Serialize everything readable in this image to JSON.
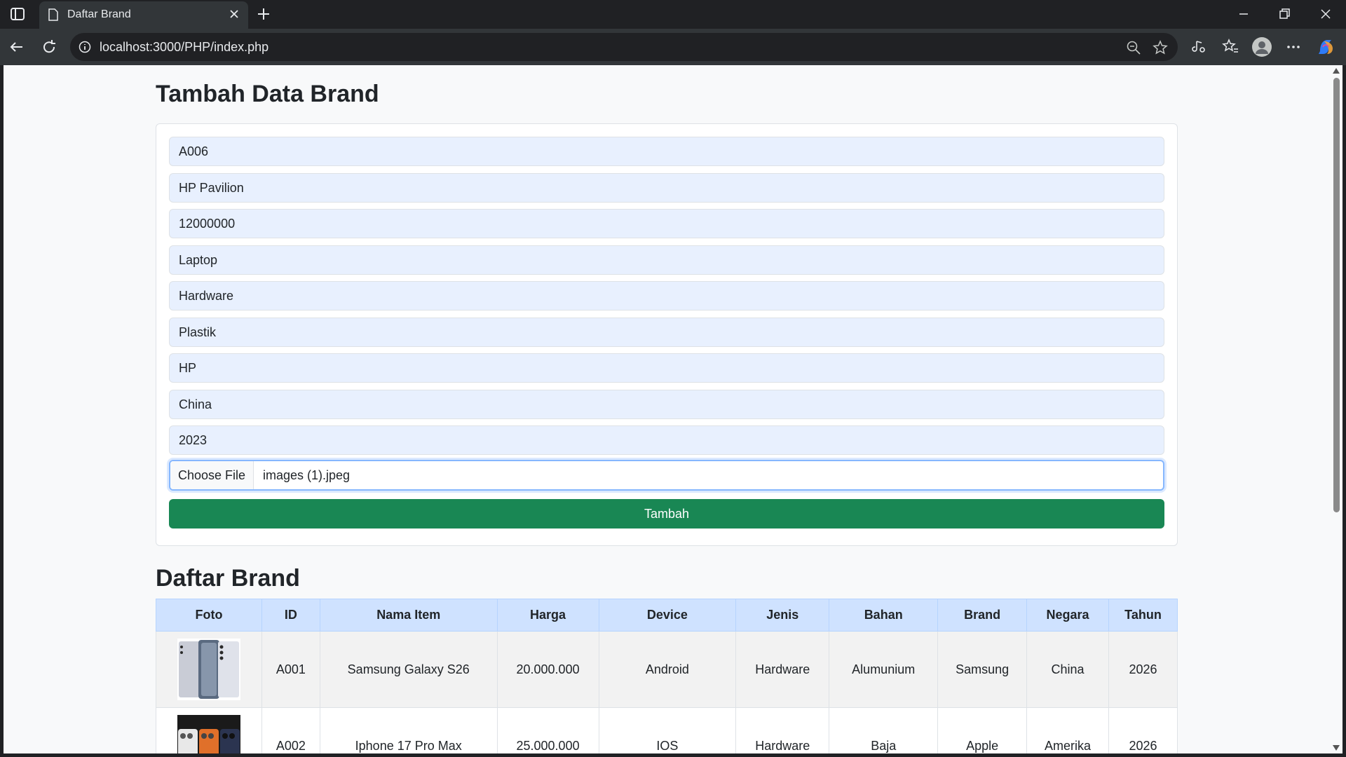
{
  "browser": {
    "tab_title": "Daftar Brand",
    "url": "localhost:3000/PHP/index.php"
  },
  "page": {
    "form_title": "Tambah Data Brand",
    "fields": [
      {
        "name": "id",
        "value": "A006"
      },
      {
        "name": "nama-item",
        "value": "HP Pavilion"
      },
      {
        "name": "harga",
        "value": "12000000"
      },
      {
        "name": "device",
        "value": "Laptop"
      },
      {
        "name": "jenis",
        "value": "Hardware"
      },
      {
        "name": "bahan",
        "value": "Plastik"
      },
      {
        "name": "brand",
        "value": "HP"
      },
      {
        "name": "negara",
        "value": "China"
      },
      {
        "name": "tahun",
        "value": "2023"
      }
    ],
    "file": {
      "button_label": "Choose File",
      "file_name": "images (1).jpeg"
    },
    "submit_label": "Tambah",
    "list_title": "Daftar Brand",
    "table": {
      "headers": [
        "Foto",
        "ID",
        "Nama Item",
        "Harga",
        "Device",
        "Jenis",
        "Bahan",
        "Brand",
        "Negara",
        "Tahun"
      ],
      "rows": [
        {
          "id": "A001",
          "nama": "Samsung Galaxy S26",
          "harga": "20.000.000",
          "device": "Android",
          "jenis": "Hardware",
          "bahan": "Alumunium",
          "brand": "Samsung",
          "negara": "China",
          "tahun": "2026",
          "photo": "samsung-phone-photo"
        },
        {
          "id": "A002",
          "nama": "Iphone 17 Pro Max",
          "harga": "25.000.000",
          "device": "IOS",
          "jenis": "Hardware",
          "bahan": "Baja",
          "brand": "Apple",
          "negara": "Amerika",
          "tahun": "2026",
          "photo": "iphone-photo"
        }
      ]
    }
  },
  "icons": {
    "sidebar": "sidebar-toggle-icon",
    "page": "page-icon",
    "close": "close-icon",
    "plus": "plus-icon",
    "back": "back-arrow-icon",
    "reload": "reload-icon",
    "info": "info-icon",
    "zoom": "zoom-out-icon",
    "star": "star-icon"
  }
}
